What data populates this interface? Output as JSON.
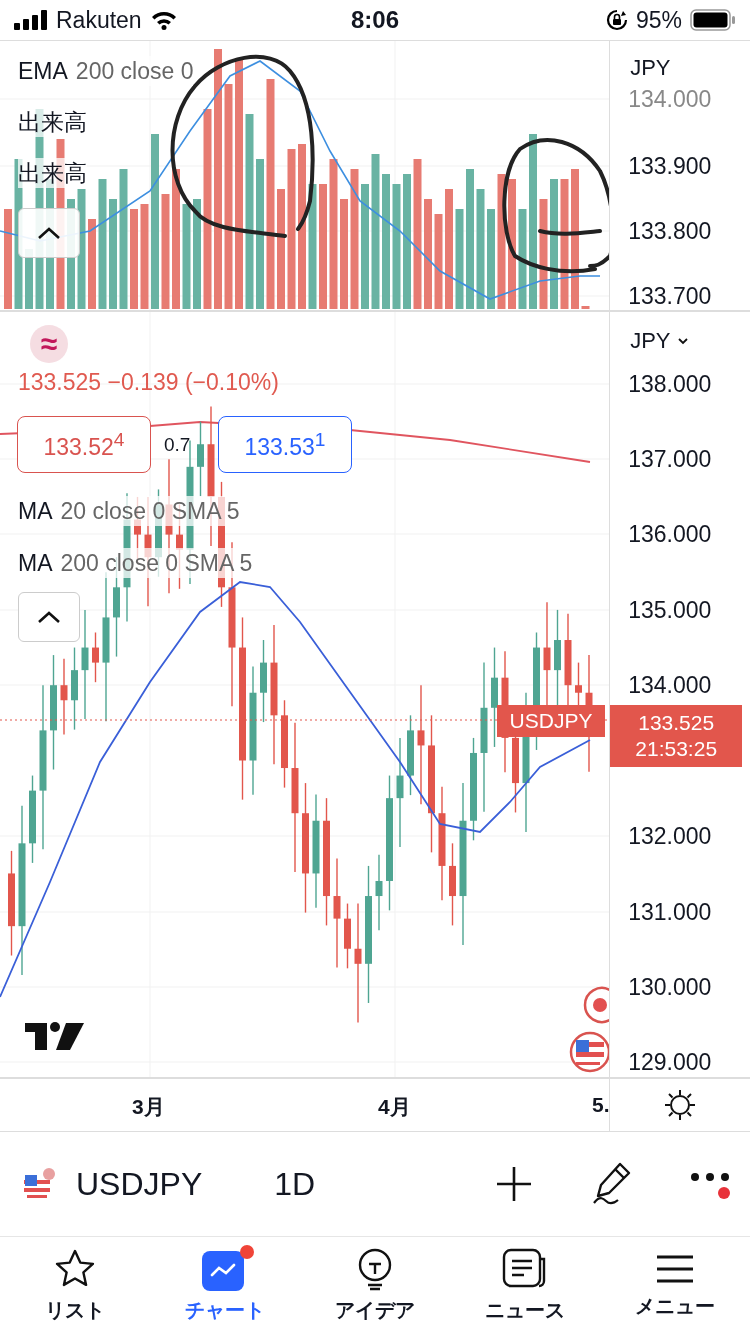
{
  "status_bar": {
    "carrier": "Rakuten",
    "time": "8:06",
    "battery": "95%"
  },
  "indicator_pane": {
    "legend": [
      {
        "name": "EMA",
        "params": "200 close 0"
      },
      {
        "name": "出来高"
      },
      {
        "name": "出来高"
      }
    ],
    "axis": {
      "currency": "JPY",
      "ticks": [
        "134.000",
        "133.900",
        "133.800",
        "133.700"
      ]
    }
  },
  "price_pane": {
    "currency_badge": "≈",
    "change_text": "133.525 −0.139 (−0.10%)",
    "bid": "133.52$^{4}$",
    "spread": "0.7",
    "ask": "133.53$^{1}$",
    "legend": [
      {
        "name": "MA",
        "params": "20 close 0 SMA 5"
      },
      {
        "name": "MA",
        "params": "200 close 0 SMA 5"
      }
    ],
    "symbol_label": "USDJPY",
    "last_price": "133.525",
    "countdown": "21:53:25",
    "axis": {
      "currency": "JPY",
      "ticks": [
        "138.000",
        "137.000",
        "136.000",
        "135.000",
        "134.000",
        "132.000",
        "131.000",
        "130.000",
        "129.000"
      ]
    }
  },
  "time_axis": {
    "labels": [
      "3月",
      "4月",
      "5."
    ]
  },
  "symbol_bar": {
    "symbol": "USDJPY",
    "interval": "1D",
    "more_badge": true
  },
  "tab_bar": [
    {
      "label": "リスト",
      "selected": false,
      "badge": false
    },
    {
      "label": "チャート",
      "selected": true,
      "badge": true
    },
    {
      "label": "アイデア",
      "selected": false,
      "badge": false
    },
    {
      "label": "ニュース",
      "selected": false,
      "badge": false
    },
    {
      "label": "メニュー",
      "selected": false,
      "badge": false
    }
  ]
}
